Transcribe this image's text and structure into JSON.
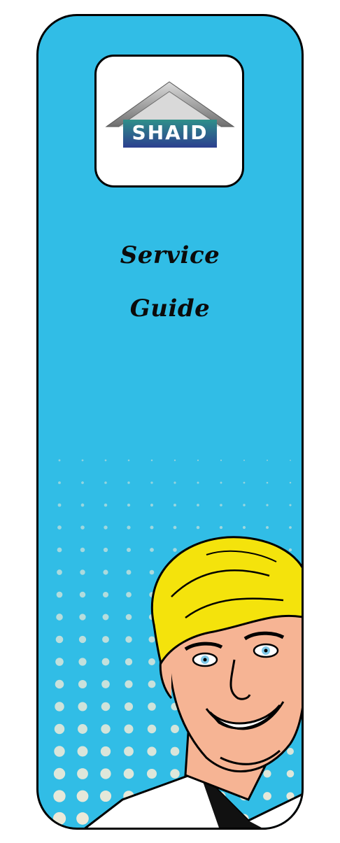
{
  "logo": {
    "text": "SHAID",
    "icon": "house-roof-logo"
  },
  "title": {
    "line1": "Service",
    "line2": "Guide"
  },
  "colors": {
    "background": "#31bde6",
    "border": "#000000",
    "logo_panel": "#ffffff",
    "halftone_dots": "#ece9d8",
    "hair": "#f4e30c",
    "skin": "#f6b494"
  },
  "illustration": "smiling-man-comic-icon"
}
